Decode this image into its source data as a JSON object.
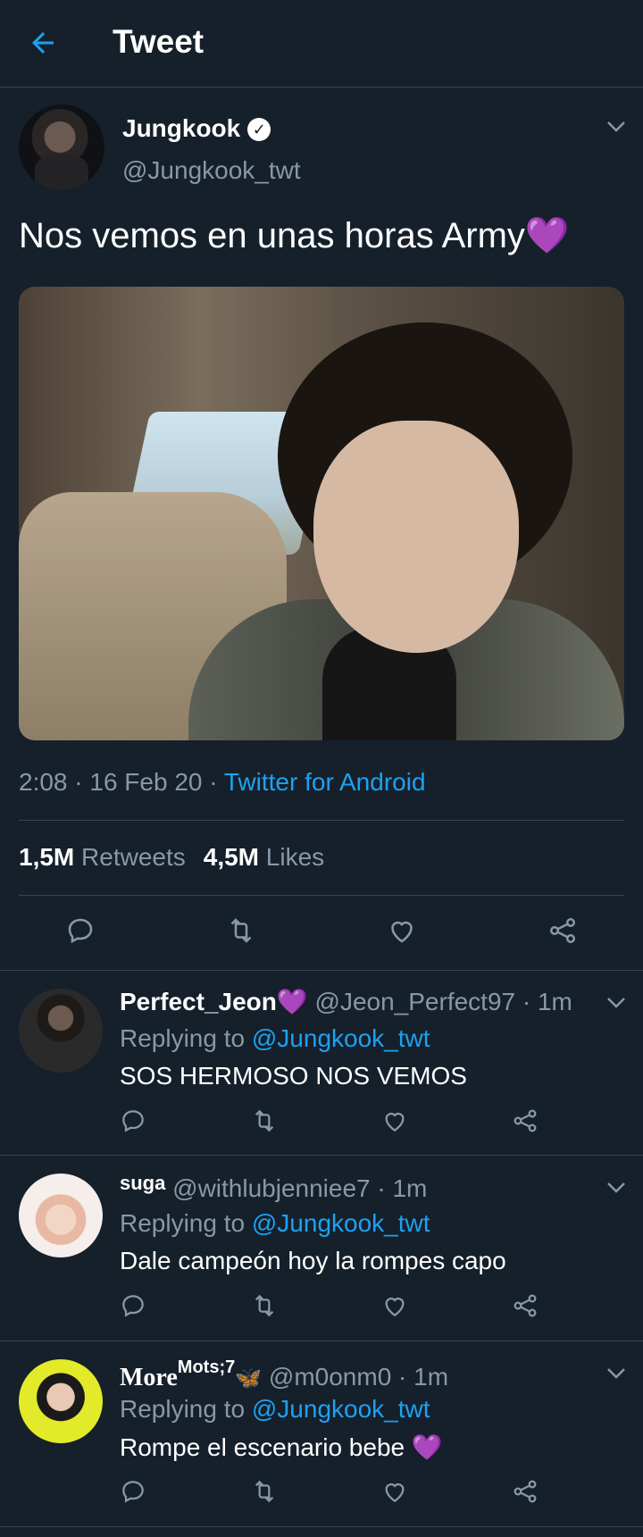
{
  "header": {
    "title": "Tweet"
  },
  "tweet": {
    "name": "Jungkook",
    "handle": "@Jungkook_twt",
    "text": "Nos vemos en unas horas Army",
    "heart": "💜",
    "time": "2:08 · 16 Feb 20 · ",
    "client": "Twitter for Android",
    "retweets_count": "1,5M",
    "retweets_label": "Retweets",
    "likes_count": "4,5M",
    "likes_label": "Likes"
  },
  "replies": [
    {
      "name": "Perfect_Jeon",
      "name_emoji": "💜",
      "handle": "@Jeon_Perfect97 · 1m",
      "replying_prefix": "Replying to ",
      "replying_to": "@Jungkook_twt",
      "text": "SOS HERMOSO NOS VEMOS"
    },
    {
      "name": "suga",
      "handle": "@withlubjenniee7 · 1m",
      "replying_prefix": "Replying to ",
      "replying_to": "@Jungkook_twt",
      "text": "Dale campeón hoy la rompes capo"
    },
    {
      "name": "More",
      "name_sup": "Mots;7",
      "name_emoji": "🦋",
      "handle": "@m0onm0 · 1m",
      "replying_prefix": "Replying to ",
      "replying_to": "@Jungkook_twt",
      "text": "Rompe el escenario bebe ",
      "text_emoji": "💜"
    }
  ],
  "icons": [
    "back-arrow-icon",
    "verified-badge-icon",
    "chevron-down-icon",
    "reply-icon",
    "retweet-icon",
    "like-icon",
    "share-icon"
  ],
  "colors": {
    "background": "#15202b",
    "accent": "#1da1f2",
    "secondary_text": "#8899a6",
    "divider": "#38444d",
    "purple_heart": "#b44cf5"
  }
}
